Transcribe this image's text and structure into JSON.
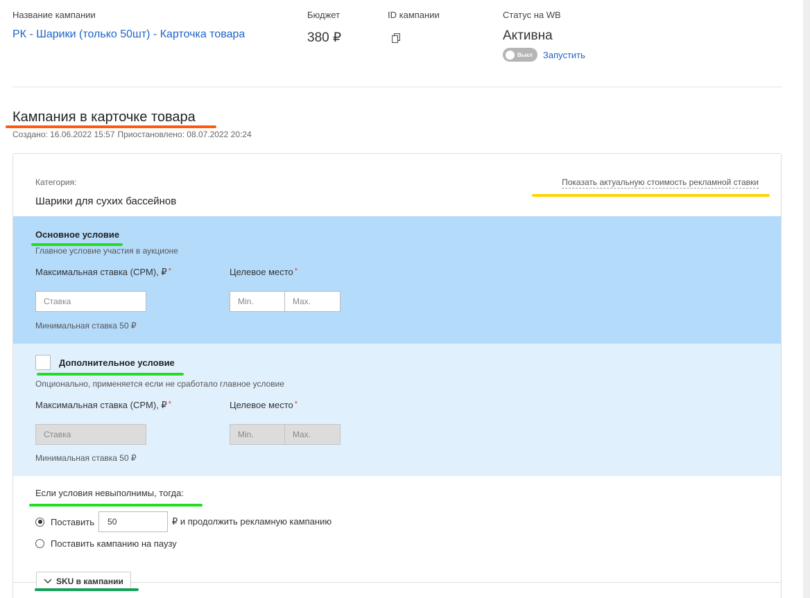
{
  "header": {
    "campaign_name_label": "Название кампании",
    "campaign_name": "РК - Шарики (только 50шт) - Карточка товара",
    "budget_label": "Бюджет",
    "budget_value": "380 ₽",
    "id_label": "ID кампании",
    "id_value": "",
    "status_label": "Статус на WB",
    "status_value": "Активна",
    "toggle_label": "Выкл",
    "launch_link": "Запустить"
  },
  "section": {
    "title": "Кампания в карточке товара",
    "created": "Создано: 16.06.2022 15:57",
    "paused": "Приостановлено: 08.07.2022 20:24"
  },
  "category": {
    "label": "Категория:",
    "value": "Шарики для сухих бассейнов",
    "show_price_link": "Показать актуальную стоимость рекламной ставки"
  },
  "main_condition": {
    "title": "Основное условие",
    "subtitle": "Главное условие участия в аукционе",
    "max_bid_label": "Максимальная ставка (CPM), ₽",
    "required_mark": "*",
    "target_place_label": "Целевое место",
    "bid_placeholder": "Ставка",
    "min_placeholder": "Min.",
    "max_placeholder": "Max.",
    "min_bid_note": "Минимальная ставка 50 ₽"
  },
  "extra_condition": {
    "title": "Дополнительное условие",
    "subtitle": "Опционально, применяется если не сработало главное условие",
    "max_bid_label": "Максимальная ставка (CPM), ₽",
    "required_mark": "*",
    "target_place_label": "Целевое место",
    "bid_placeholder": "Ставка",
    "min_placeholder": "Min.",
    "max_placeholder": "Max.",
    "min_bid_note": "Минимальная ставка 50 ₽"
  },
  "fallback": {
    "title": "Если условия невыполнимы, тогда:",
    "option1_prefix": "Поставить",
    "option1_value": "50",
    "option1_suffix": "₽ и продолжить рекламную кампанию",
    "option2_label": "Поставить кампанию на паузу"
  },
  "sku": {
    "button_label": "SKU в кампании"
  },
  "colors": {
    "link": "#1e64c8",
    "main_condition_bg": "#b5dbfb",
    "extra_condition_bg": "#e1f0fd",
    "annotation_orange": "#ff5a10",
    "annotation_yellow": "#ffd400",
    "annotation_green": "#22dd22",
    "annotation_dark_green": "#11a055"
  },
  "icons": {
    "copy": "copy-icon",
    "chevron": "chevron-down-icon",
    "toggle": "toggle-switch"
  }
}
